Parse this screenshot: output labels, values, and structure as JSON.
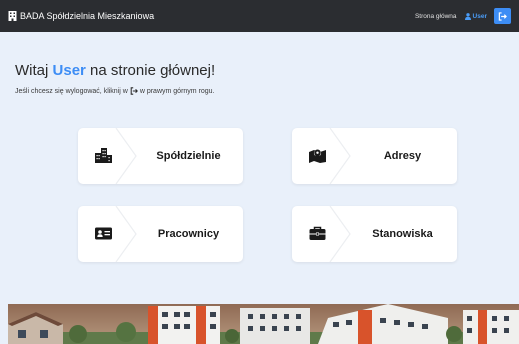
{
  "navbar": {
    "brand": "BADA Spółdzielnia Mieszkaniowa",
    "home_link": "Strona główna",
    "user_label": "User",
    "brand_icon": "building-icon",
    "user_icon": "user-icon",
    "logout_icon": "logout-icon"
  },
  "welcome": {
    "prefix": "Witaj",
    "user": "User",
    "suffix": "na stronie głównej!"
  },
  "hint": {
    "before": "Jeśli chcesz się wylogować, kliknij w",
    "after": "w prawym górnym rogu."
  },
  "cards": [
    {
      "label": "Spółdzielnie",
      "icon": "city-icon"
    },
    {
      "label": "Adresy",
      "icon": "map-location-icon"
    },
    {
      "label": "Pracownicy",
      "icon": "id-card-icon"
    },
    {
      "label": "Stanowiska",
      "icon": "briefcase-icon"
    }
  ],
  "colors": {
    "navbar_bg": "#2b2d31",
    "page_bg": "#e9f0fa",
    "accent": "#3d8df5"
  }
}
